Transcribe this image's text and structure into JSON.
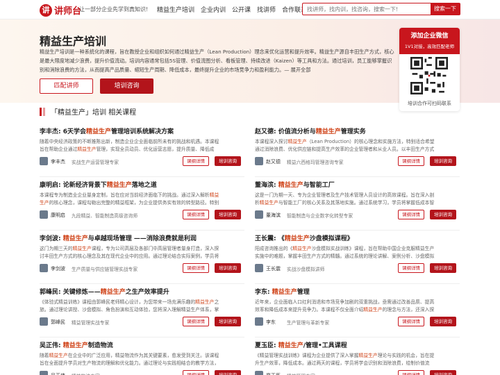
{
  "header": {
    "logo_mark": "讲",
    "logo_text": "讲师台",
    "slogan": "让一部分企业先学到真知识!",
    "nav": [
      "精益生产培训",
      "企业内训",
      "公开课",
      "找讲师",
      "合作联系"
    ],
    "search_placeholder": "找讲师，找内训，找咨询，搜索一下!",
    "search_button": "搜索一下"
  },
  "hero": {
    "title": "精益生产培训",
    "description": "精益生产培训是一种系统化的课程，旨在教授企业和组织如何通过精益生产（Lean Production）理念来优化运营和提升效率。精益生产源自丰田生产方式，核心是最大限度地减少浪费，提升价值流动。培训内容通常包括5S管理、价值流图分析、看板管理、持续改进（Kaizen）等工具和方法。通过培训，员工能够掌握识别和消除浪费的方法，从而提高产品质量、缩短生产周期、降低成本，最终提升企业的市场竞争力和盈利能力。— 展开全部",
    "btn_match": "匹配讲师",
    "btn_consult": "培训咨询"
  },
  "qr": {
    "title": "添加企业微信",
    "subtitle": "1V1对接，高效匹配老师",
    "caption": "培训合作可扫码联系"
  },
  "section": {
    "title": "「精益生产」培训 相关课程"
  },
  "cards": [
    {
      "title_pre": "李丰杰: 6天学会",
      "title_hl": "精益生产",
      "title_post": "管理培训系统解决方案",
      "desc_pre": "随着中央经济政策的不断推陈出新，制造企业企业面临前所未有的挑战和机遇。本课程旨在帮助企业通过",
      "desc_hl": "精益生产",
      "desc_post": "管理，实现全员动员、优化运营志愿，提升质量、降低成本、改善管理。课",
      "teacher": "李丰杰",
      "tag": "实战生产运营管理专家",
      "btn_detail": "课纲详情",
      "btn_consult": "培训咨询"
    },
    {
      "title_pre": "赵又德: 价值流分析与",
      "title_hl": "精益生产",
      "title_post": "管理实务",
      "desc_pre": "本课程深入探讨",
      "desc_hl": "精益生产",
      "desc_post": "（Lean Production）的核心理念和实施方法，特别适合希望通过消除浪费、优化供应链和提高生产效率的企业管理者和从业人员。以丰田生产方式为基础，课程将带",
      "teacher": "赵又德",
      "tag": "精益六西格玛管理咨询专家",
      "btn_detail": "课纲详情",
      "btn_consult": "培训咨询"
    },
    {
      "title_pre": "康明启: 论新经济背景下",
      "title_hl": "精益生产",
      "title_post": "落地之道",
      "desc_pre": "本课程专为制造业企业量身定制，旨在应对当前经济面临下的挑战。通过深入解析",
      "desc_hl": "精益生产",
      "desc_post": "的核心理念，课程勾勒出完整的精益框架，为企业提供务实有效的转型路径。特别是围绕九问",
      "teacher": "康明启",
      "tag": "九段精益、智能制造高级咨询师",
      "btn_detail": "课纲详情",
      "btn_consult": "培训咨询"
    },
    {
      "title_pre": "董海滨: ",
      "title_hl": "精益生产",
      "title_post": "与智能工厂",
      "desc_pre": "这是一门为期一天、专为企业管理者及生产技术管理人员设计的高效课程。旨在深入剖析",
      "desc_hl": "精益生产",
      "desc_post": "与智能工厂的核心关系及其落地实施。通过系统学习，学员将掌握低成本智能工厂的",
      "teacher": "董海滨",
      "tag": "智能制造与企业数字化转型专家",
      "btn_detail": "课纲详情",
      "btn_consult": "培训咨询"
    },
    {
      "title_pre": "李剑波: ",
      "title_hl": "精益生产",
      "title_post": "与卓越现场管理 ——消除浪费就是利润",
      "desc_pre": "这门为期三天的",
      "desc_hl": "精益生产",
      "desc_post": "课程，专为公司高层及各部门中高层管理者量身打造，深入探讨丰田生产方式的核心理念及其在现代企业中的应用。通过理论结合实际案例，学员将掌握精益生产的",
      "teacher": "李剑波",
      "tag": "生产质量与供应链管理实战专家",
      "btn_detail": "课纲详情",
      "btn_consult": "培训咨询"
    },
    {
      "title_pre": "王长震: 《",
      "title_hl": "精益生产",
      "title_post": "沙盘模拟课程》",
      "desc_pre": "阳成咨询推出的《",
      "desc_hl": "精益生产",
      "desc_post": "沙盘模拟实战训练》课程，旨在帮助中国企业克服精益生产实施中的难题，掌握丰田生产方式的精髓。通过系统的理论讲解、案例分析、沙盘模拟和实践练习，学",
      "teacher": "王长震",
      "tag": "实战沙盘模拟讲师",
      "btn_detail": "课纲详情",
      "btn_consult": "培训咨询"
    },
    {
      "title_pre": "郭峰民: 关键修炼——",
      "title_hl": "精益生产",
      "title_post": "之生产效率提升",
      "desc_pre": "《体验式精益训练》课程由郭峰民老师精心设计，为您带来一场充满乐趣的",
      "desc_hl": "精益生产",
      "desc_post": "之旅。通过理论讲授、沙盘模拟、角色扮演和互动体验，您将深入理解精益生产体系，掌握高效管理工具",
      "teacher": "郭峰民",
      "tag": "精益管理实战专家",
      "btn_detail": "课纲详情",
      "btn_consult": "培训咨询"
    },
    {
      "title_pre": "李东: ",
      "title_hl": "精益生产",
      "title_post": "管理",
      "desc_pre": "近年来，企业面临人口红利消退和市场竞争加剧的双重挑战，亟需通过改善品质、提高效率和降低成本来提升竞争力。本课程不仅全面介绍",
      "desc_hl": "精益生产",
      "desc_post": "的理念与方法，还深入探讨如何将精益",
      "teacher": "李东",
      "tag": "生产管理与革新专家",
      "btn_detail": "课纲详情",
      "btn_consult": "培训咨询"
    },
    {
      "title_pre": "吴正伟: ",
      "title_hl": "精益生产",
      "title_post": "制造物流",
      "desc_pre": "随着",
      "desc_hl": "精益生产",
      "desc_post": "在企业中的广泛应用，精益物流作为其关键要素，愈发受到关注。该课程旨在全面提升学员对生产物流的理解和优化能力。通过理论与实践相结合的教学方法，涵盖从物流概念",
      "teacher": "吴正伟",
      "tag": "精益物流专家",
      "btn_detail": "课纲详情",
      "btn_consult": "培训咨询"
    },
    {
      "title_pre": "夏玉臣: ",
      "title_hl": "精益生产",
      "title_post": "/管理•工具课程",
      "desc_pre": "《精益管理实战训练》课程为企业提供了深入掌握",
      "desc_hl": "精益生产",
      "desc_post": "理论与实践的机会，旨在提升生产效率，降低成本。通过两天的课程，学员将学会识别和消除浪费，绘制价值流图，优化工厂",
      "teacher": "夏玉臣",
      "tag": "精益管理专家",
      "btn_detail": "课纲详情",
      "btn_consult": "培训咨询"
    }
  ]
}
